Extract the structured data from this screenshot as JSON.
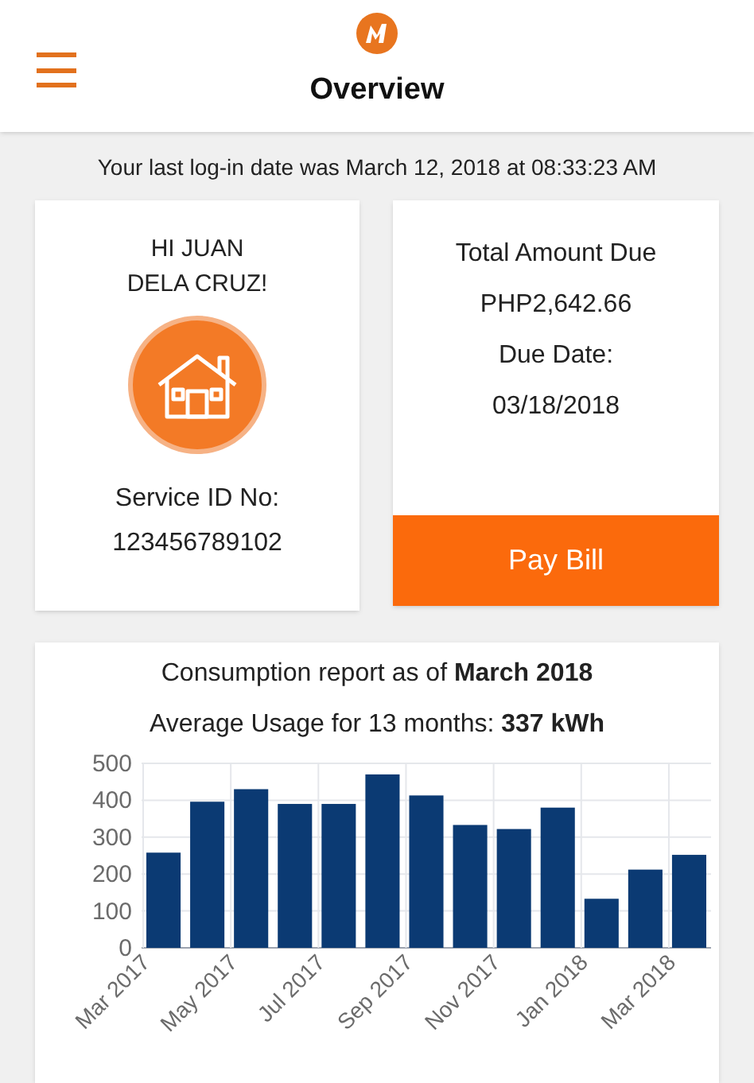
{
  "header": {
    "title": "Overview"
  },
  "last_login": "Your last log-in date was March 12, 2018 at 08:33:23 AM",
  "greeting": {
    "lines": [
      "HI JUAN",
      "DELA CRUZ!"
    ],
    "service_label": "Service ID No:",
    "service_id": "123456789102"
  },
  "bill": {
    "amount_label": "Total Amount Due",
    "amount": "PHP2,642.66",
    "due_label": "Due Date:",
    "due_date": "03/18/2018",
    "button": "Pay Bill"
  },
  "report": {
    "title": "Consumption report as of **March 2018**",
    "subtitle": "Average Usage for 13 months: **337 kWh**",
    "chart_data": {
      "type": "bar",
      "categories": [
        "Mar 2017",
        null,
        "May 2017",
        null,
        "Jul 2017",
        null,
        "Sep 2017",
        null,
        "Nov 2017",
        null,
        "Jan 2018",
        null,
        "Mar 2018"
      ],
      "series": [
        {
          "color": "#0b3a73",
          "values": [
            258,
            396,
            430,
            390,
            390,
            470,
            413,
            333,
            322,
            380,
            133,
            212,
            252
          ]
        }
      ],
      "ylim": [
        0,
        500
      ],
      "yticks": [
        0,
        100,
        200,
        300,
        400,
        500
      ],
      "grid": true
    }
  }
}
